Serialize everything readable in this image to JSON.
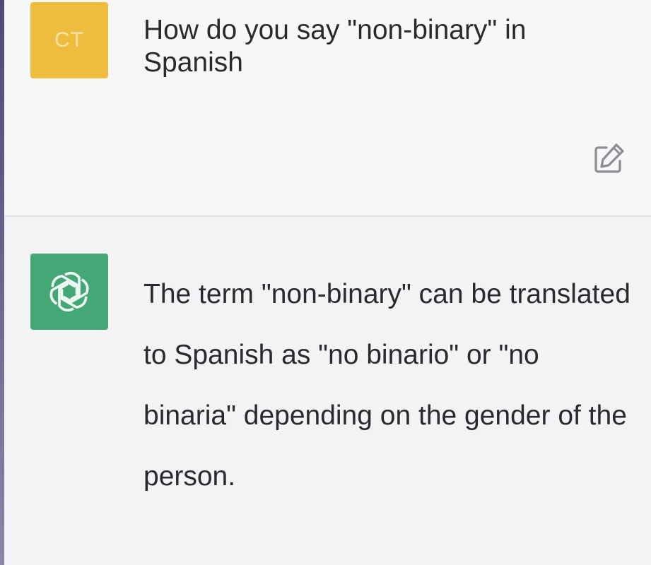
{
  "conversation": {
    "user": {
      "avatar_initials": "CT",
      "avatar_color": "#efbd3e",
      "message": "How do you say \"non-binary\" in Spanish",
      "edit_icon": "edit-icon"
    },
    "assistant": {
      "avatar_icon": "openai-logo-icon",
      "avatar_color": "#43a876",
      "message": "The term \"non-binary\" can be translated to Spanish as \"no binario\" or \"no binaria\" depending on the gender of the person."
    }
  }
}
